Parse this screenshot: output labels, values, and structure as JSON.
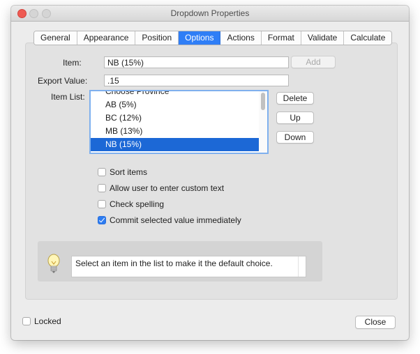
{
  "window": {
    "title": "Dropdown Properties"
  },
  "tabs": [
    {
      "label": "General"
    },
    {
      "label": "Appearance"
    },
    {
      "label": "Position"
    },
    {
      "label": "Options",
      "active": true
    },
    {
      "label": "Actions"
    },
    {
      "label": "Format"
    },
    {
      "label": "Validate"
    },
    {
      "label": "Calculate"
    }
  ],
  "options": {
    "item_label": "Item:",
    "item_value": "NB (15%)",
    "add_button": "Add",
    "export_label": "Export Value:",
    "export_value": ".15",
    "item_list_label": "Item List:",
    "list_items": [
      "Choose Province",
      "AB (5%)",
      "BC (12%)",
      "MB (13%)",
      "NB (15%)"
    ],
    "selected_item": "NB (15%)",
    "delete_button": "Delete",
    "up_button": "Up",
    "down_button": "Down",
    "checkboxes": [
      {
        "label": "Sort items",
        "checked": false
      },
      {
        "label": "Allow user to enter custom text",
        "checked": false
      },
      {
        "label": "Check spelling",
        "checked": false
      },
      {
        "label": "Commit selected value immediately",
        "checked": true
      }
    ],
    "hint_text": "Select an item in the list to make it the default choice."
  },
  "footer": {
    "locked_label": "Locked",
    "locked_checked": false,
    "close_button": "Close"
  },
  "colors": {
    "accent": "#2f7ef6",
    "selection": "#1c68d6",
    "close_button": "#ee5a52"
  },
  "icons": {
    "hint": "lightbulb-icon"
  }
}
